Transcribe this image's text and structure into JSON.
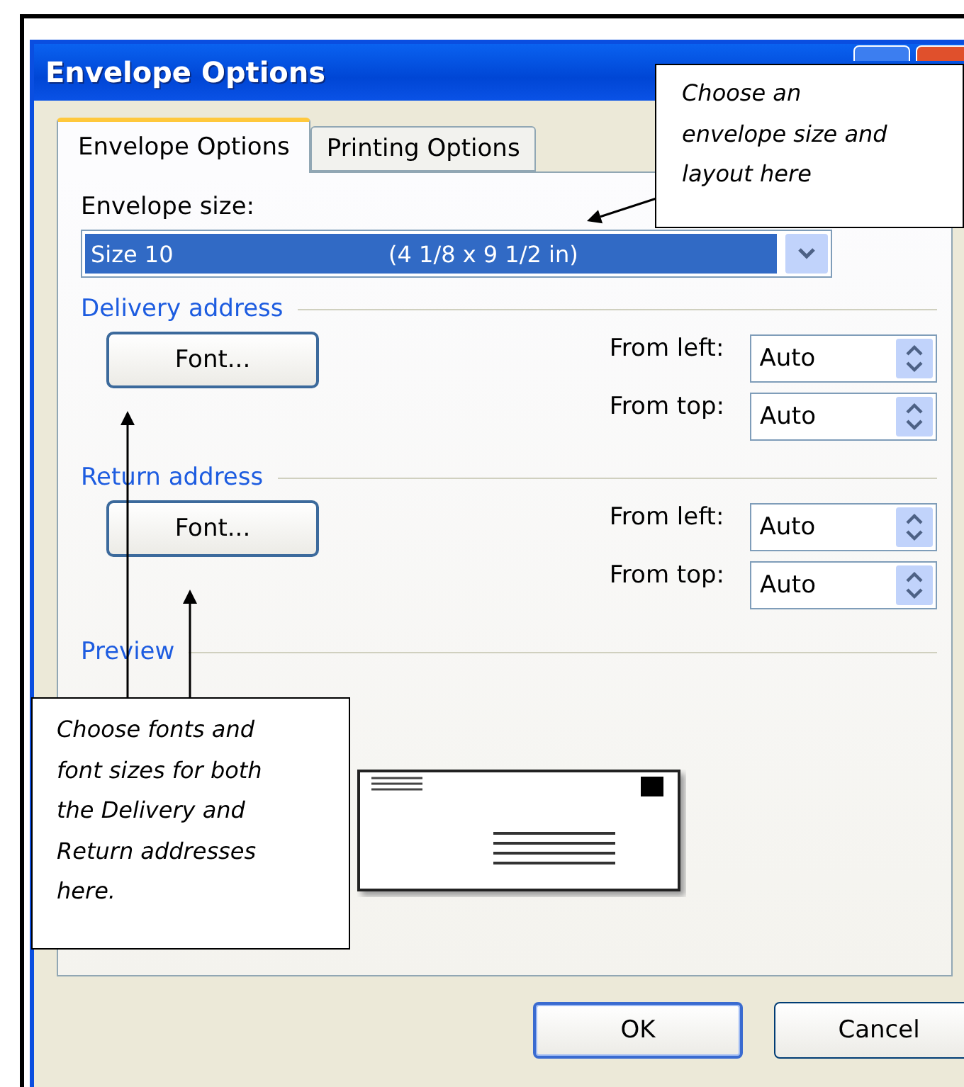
{
  "window": {
    "title": "Envelope Options"
  },
  "tabs": [
    {
      "label": "Envelope Options",
      "selected": true
    },
    {
      "label": "Printing Options",
      "selected": false
    }
  ],
  "envelope_size": {
    "label": "Envelope size:",
    "value": "Size 10",
    "dimensions": "(4 1/8 x 9 1/2 in)"
  },
  "sections": [
    {
      "heading": "Delivery address",
      "font_button": "Font...",
      "fields": [
        {
          "label": "From left:",
          "value": "Auto"
        },
        {
          "label": "From top:",
          "value": "Auto"
        }
      ]
    },
    {
      "heading": "Return address",
      "font_button": "Font...",
      "fields": [
        {
          "label": "From left:",
          "value": "Auto"
        },
        {
          "label": "From top:",
          "value": "Auto"
        }
      ]
    }
  ],
  "preview": {
    "heading": "Preview"
  },
  "buttons": [
    {
      "label": "OK",
      "default": true
    },
    {
      "label": "Cancel",
      "default": false
    }
  ],
  "callouts": [
    {
      "text": "Choose an envelope size and layout here"
    },
    {
      "text": "Choose fonts and font sizes for both the Delivery and Return addresses here."
    }
  ]
}
